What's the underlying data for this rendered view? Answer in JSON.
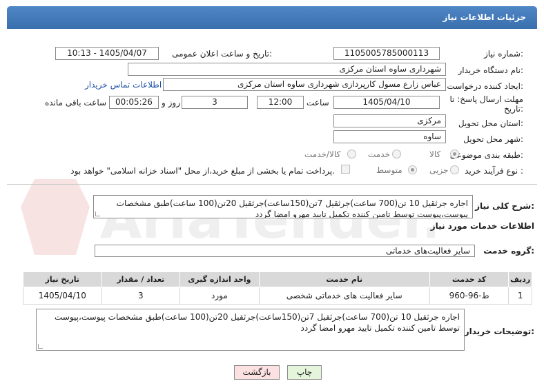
{
  "header": {
    "title": "جزئیات اطلاعات نیاز"
  },
  "fields": {
    "need_number_label": "شماره نیاز:",
    "need_number": "1105005785000113",
    "announce_label": "تاریخ و ساعت اعلان عمومی:",
    "announce_value": "1405/04/07 - 10:13",
    "buyer_org_label": "نام دستگاه خریدار:",
    "buyer_org": "شهرداری ساوه استان مرکزی",
    "creator_label": "ایجاد کننده درخواست:",
    "creator": "عباس زارع مسول کارپردازی شهرداری ساوه استان مرکزی",
    "contact_link": "اطلاعات تماس خریدار",
    "deadline_label_1": "مهلت ارسال پاسخ: تا",
    "deadline_label_2": "تاریخ:",
    "deadline_date": "1405/04/10",
    "time_label": "ساعت",
    "deadline_time": "12:00",
    "days_value": "3",
    "days_label": "روز و",
    "remaining_time": "00:05:26",
    "remaining_label": "ساعت باقی مانده",
    "province_label": "استان محل تحویل:",
    "province": "مرکزی",
    "city_label": "شهر محل تحویل:",
    "city": "ساوه",
    "category_label": "طبقه بندی موضوعی:",
    "category_options": [
      "کالا",
      "خدمت",
      "کالا/خدمت"
    ],
    "process_label": "نوع فرآیند خرید :",
    "process_options": [
      "جزیی",
      "متوسط"
    ],
    "treasury_note": "پرداخت تمام یا بخشی از مبلغ خرید،از محل \"اسناد خزانه اسلامی\" خواهد بود."
  },
  "summary": {
    "label": "شرح کلی نیاز:",
    "text": "اجاره جرثقیل 10 تن(700 ساعت)جرثقیل 7تن(150ساعت)جرثقیل 20تن(100 ساعت)طبق مشخصات پیوست،پیوست توسط تامین کننده تکمیل تایید مهرو امضا گردد"
  },
  "services": {
    "title": "اطلاعات خدمات مورد نیاز",
    "group_label": "گروه خدمت:",
    "group_value": "سایر فعالیت‌های خدماتی",
    "columns": [
      "ردیف",
      "کد خدمت",
      "نام خدمت",
      "واحد اندازه گیری",
      "تعداد / مقدار",
      "تاریخ نیاز"
    ],
    "rows": [
      [
        "1",
        "ط-96-960",
        "سایر فعالیت های خدماتی شخصی",
        "مورد",
        "3",
        "1405/04/10"
      ]
    ]
  },
  "buyer_notes": {
    "label": "توضیحات خریدار:",
    "text": "اجاره جرثقیل 10 تن(700 ساعت)جرثقیل 7تن(150ساعت)جرثقیل 20تن(100 ساعت)طبق مشخصات پیوست،پیوست توسط تامین کننده تکمیل تایید مهرو امضا گردد"
  },
  "buttons": {
    "print": "چاپ",
    "back": "بازگشت"
  },
  "watermark": "AriaTender.net",
  "colors": {
    "header": "#3f77b8",
    "print_btn": "#e4f5dc",
    "back_btn": "#fbe1e1",
    "link": "#1a4fa3"
  }
}
